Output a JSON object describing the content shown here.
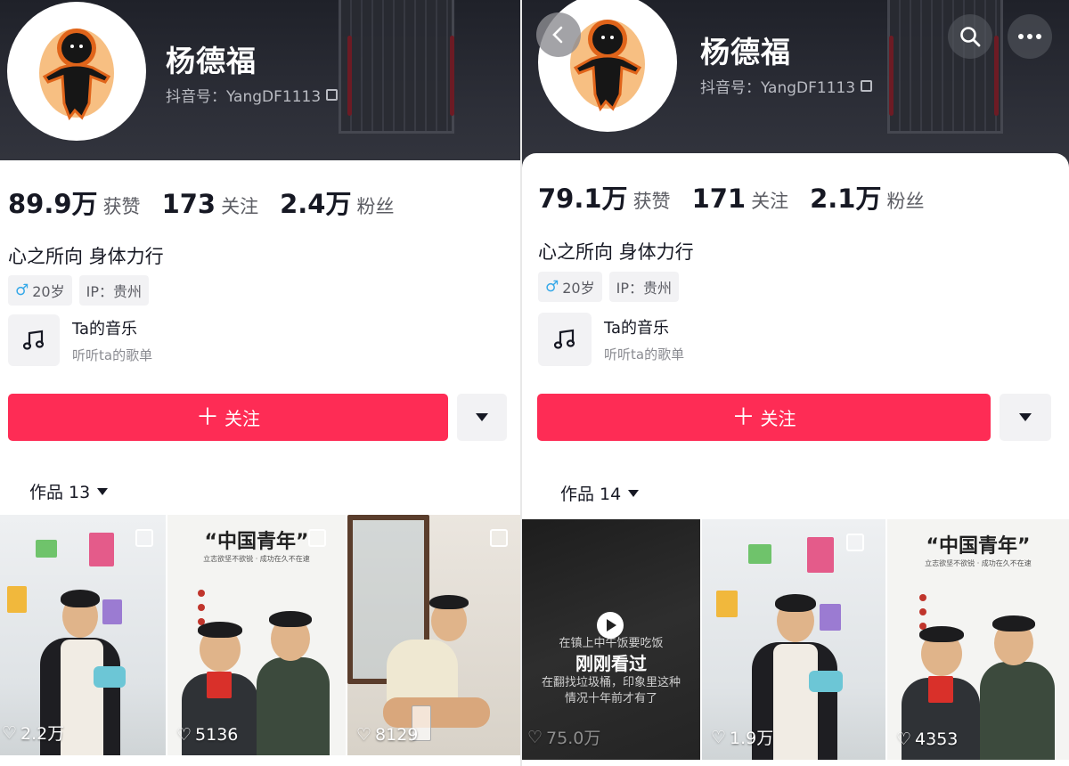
{
  "left": {
    "nickname": "杨德福",
    "douyin_id": "抖音号：YangDF1113",
    "stats": {
      "likes": "89.9万",
      "likes_label": "获赞",
      "following": "173",
      "following_label": "关注",
      "followers": "2.4万",
      "followers_label": "粉丝"
    },
    "bio": "心之所向 身体力行",
    "tags": {
      "age": "20岁",
      "ip": "IP：贵州"
    },
    "music": {
      "title": "Ta的音乐",
      "subtitle": "听听ta的歌单"
    },
    "follow_label": "关注",
    "works_tab": "作品 13",
    "thumbnails": [
      {
        "likes": "2.2万"
      },
      {
        "title": "“中国青年”",
        "subtitle": "立志欲坚不欲锐 · 成功在久不在速",
        "likes": "5136"
      },
      {
        "likes": "8129"
      }
    ]
  },
  "right": {
    "nickname": "杨德福",
    "douyin_id": "抖音号：YangDF1113",
    "stats": {
      "likes": "79.1万",
      "likes_label": "获赞",
      "following": "171",
      "following_label": "关注",
      "followers": "2.1万",
      "followers_label": "粉丝"
    },
    "bio": "心之所向 身体力行",
    "tags": {
      "age": "20岁",
      "ip": "IP：贵州"
    },
    "music": {
      "title": "Ta的音乐",
      "subtitle": "听听ta的歌单"
    },
    "follow_label": "关注",
    "works_tab": "作品 14",
    "thumbnails": [
      {
        "line1": "在镇上中午饭要吃饭",
        "viewed": "刚刚看过",
        "line2": "在翻找垃圾桶，印象里这种",
        "line3": "情况十年前才有了",
        "likes": "75.0万"
      },
      {
        "likes": "1.9万"
      },
      {
        "title": "“中国青年”",
        "subtitle": "立志欲坚不欲锐 · 成功在久不在速",
        "likes": "4353"
      }
    ]
  },
  "icons": {
    "back": "back-arrow-icon",
    "search": "search-icon",
    "more": "more-dots-icon",
    "copy": "copy-icon",
    "music": "music-note-icon",
    "heart": "heart-icon",
    "play": "play-icon",
    "male": "male-icon"
  },
  "colors": {
    "follow_button": "#fe2c55",
    "header": "#2c2e37",
    "male": "#35a8e8"
  }
}
